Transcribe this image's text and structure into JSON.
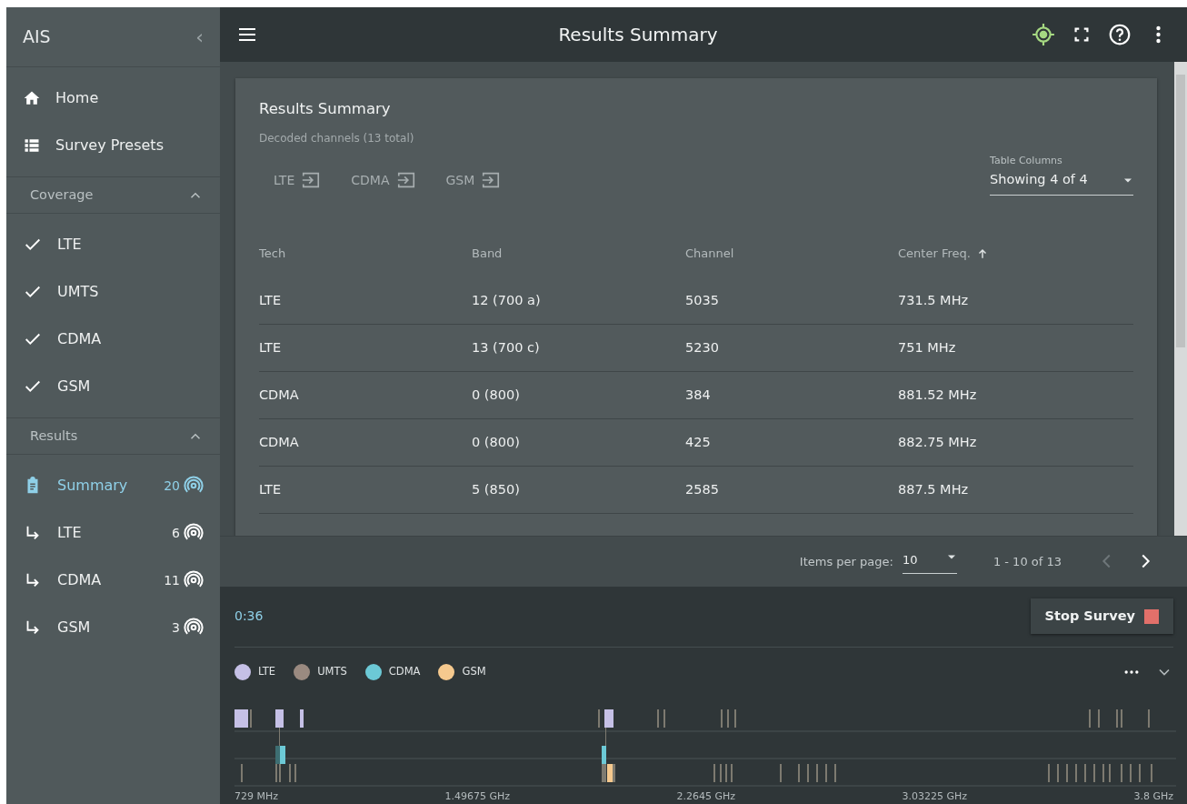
{
  "sidebar": {
    "title": "AIS",
    "collapse_icon": "‹",
    "nav": [
      {
        "label": "Home",
        "kind": "home"
      },
      {
        "label": "Survey Presets",
        "kind": "list"
      }
    ],
    "sections": [
      {
        "title": "Coverage",
        "expanded": true,
        "items": [
          {
            "label": "LTE",
            "checked": true
          },
          {
            "label": "UMTS",
            "checked": true
          },
          {
            "label": "CDMA",
            "checked": true
          },
          {
            "label": "GSM",
            "checked": true
          }
        ]
      },
      {
        "title": "Results",
        "expanded": true,
        "items": [
          {
            "kind": "summary",
            "label": "Summary",
            "count": "20",
            "selected": true
          },
          {
            "kind": "sub",
            "label": "LTE",
            "count": "6",
            "selected": false
          },
          {
            "kind": "sub",
            "label": "CDMA",
            "count": "11",
            "selected": false
          },
          {
            "kind": "sub",
            "label": "GSM",
            "count": "3",
            "selected": false
          }
        ]
      }
    ]
  },
  "toolbar": {
    "title": "Results Summary"
  },
  "card": {
    "title": "Results Summary",
    "subtitle": "Decoded channels (13 total)",
    "exports": [
      "LTE",
      "CDMA",
      "GSM"
    ],
    "column_select": {
      "label": "Table Columns",
      "value": "Showing 4 of 4"
    },
    "table": {
      "columns": [
        {
          "label": "Tech",
          "sorted": false
        },
        {
          "label": "Band",
          "sorted": false
        },
        {
          "label": "Channel",
          "sorted": false
        },
        {
          "label": "Center Freq.",
          "sorted": true
        }
      ],
      "rows": [
        [
          "LTE",
          "12 (700 a)",
          "5035",
          "731.5 MHz"
        ],
        [
          "LTE",
          "13 (700 c)",
          "5230",
          "751 MHz"
        ],
        [
          "CDMA",
          "0 (800)",
          "384",
          "881.52 MHz"
        ],
        [
          "CDMA",
          "0 (800)",
          "425",
          "882.75 MHz"
        ],
        [
          "LTE",
          "5 (850)",
          "2585",
          "887.5 MHz"
        ]
      ]
    }
  },
  "paginator": {
    "label": "Items per page:",
    "page_size": "10",
    "range": "1 - 10 of 13",
    "prev_disabled": true,
    "next_disabled": false
  },
  "survey": {
    "elapsed": "0:36",
    "stop_label": "Stop Survey",
    "legend": [
      {
        "label": "LTE",
        "color": "#c5c0e6"
      },
      {
        "label": "UMTS",
        "color": "#9a8a80"
      },
      {
        "label": "CDMA",
        "color": "#6cc9d6"
      },
      {
        "label": "GSM",
        "color": "#f5c98e"
      }
    ],
    "axis_labels": [
      "729 MHz",
      "1.49675 GHz",
      "2.2645 GHz",
      "3.03225 GHz",
      "3.8 GHz"
    ]
  }
}
